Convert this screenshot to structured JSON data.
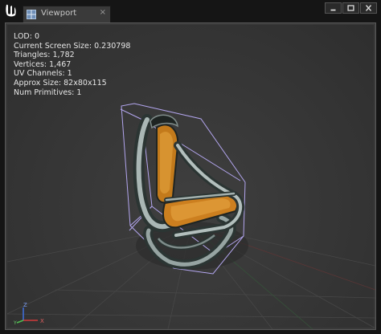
{
  "window": {
    "tab_label": "Viewport",
    "tab_close": "×"
  },
  "stats": [
    "LOD:  0",
    "Current Screen Size:  0.230798",
    "Triangles:  1,782",
    "Vertices:  1,467",
    "UV Channels:  1",
    "Approx Size: 82x80x115",
    "Num Primitives:  1"
  ],
  "axis": {
    "x": "X",
    "y": "Y",
    "z": "Z"
  },
  "colors": {
    "background": "#151515",
    "viewport": "#3a3a3a",
    "seat_cushion": "#d2861f",
    "frame_metal": "#9aa8a6",
    "bounds": "#b3a6ef"
  },
  "icons": {
    "logo": "unreal-engine-logo",
    "tab": "viewport-icon",
    "minimize": "minimize-icon",
    "maximize": "maximize-icon",
    "close": "close-icon"
  }
}
